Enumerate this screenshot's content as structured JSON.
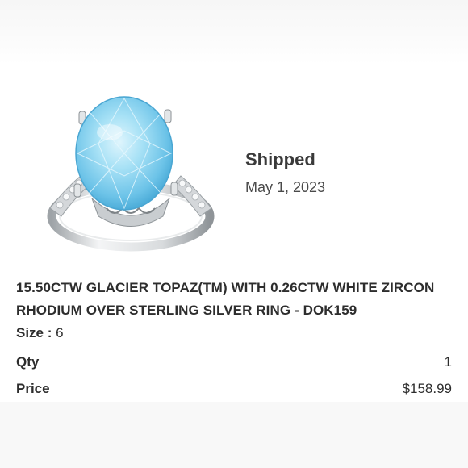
{
  "order": {
    "status": "Shipped",
    "date": "May 1, 2023"
  },
  "product": {
    "name": "15.50CTW GLACIER TOPAZ(TM) WITH 0.26CTW WHITE ZIRCON RHODIUM OVER STERLING SILVER RING - DOK159",
    "size_label": "Size :",
    "size_value": "6",
    "qty_label": "Qty",
    "qty_value": "1",
    "price_label": "Price",
    "price_value": "$158.99",
    "image_icon": "ring-image"
  },
  "colors": {
    "topaz": "#8fd3ee",
    "silver": "#cfd3d6",
    "text": "#2d2d2d"
  }
}
